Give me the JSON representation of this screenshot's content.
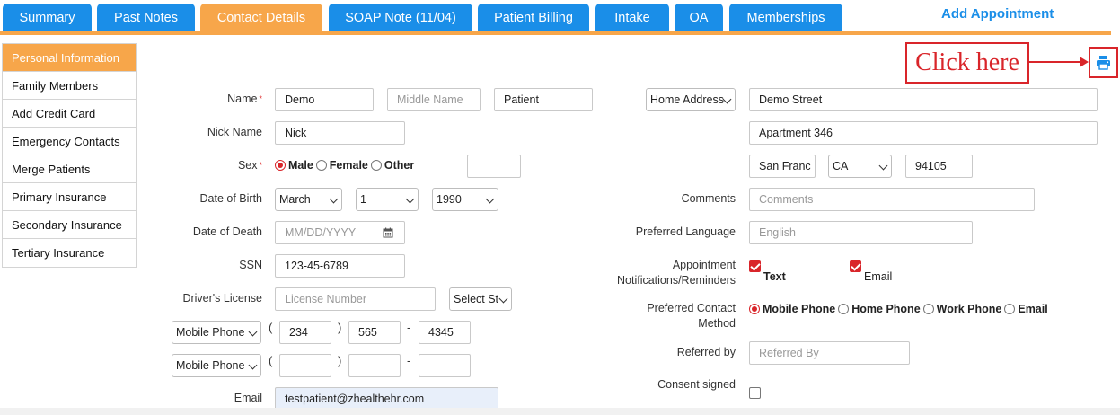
{
  "tabs": [
    {
      "label": "Summary"
    },
    {
      "label": "Past Notes"
    },
    {
      "label": "Contact Details"
    },
    {
      "label": "SOAP Note (11/04)"
    },
    {
      "label": "Patient Billing"
    },
    {
      "label": "Intake"
    },
    {
      "label": "OA"
    },
    {
      "label": "Memberships"
    }
  ],
  "active_tab": "Contact Details",
  "add_appointment": "Add Appointment",
  "sidebar": {
    "items": [
      {
        "label": "Personal Information"
      },
      {
        "label": "Family Members"
      },
      {
        "label": "Add Credit Card"
      },
      {
        "label": "Emergency Contacts"
      },
      {
        "label": "Merge Patients"
      },
      {
        "label": "Primary Insurance"
      },
      {
        "label": "Secondary Insurance"
      },
      {
        "label": "Tertiary Insurance"
      }
    ]
  },
  "annotation": {
    "callout_text": "Click here"
  },
  "form": {
    "name": {
      "label": "Name",
      "required_mark": "*",
      "first": "Demo",
      "middle_placeholder": "Middle Name",
      "last": "Patient"
    },
    "nick_name": {
      "label": "Nick Name",
      "value": "Nick"
    },
    "sex": {
      "label": "Sex",
      "required_mark": "*",
      "options": [
        "Male",
        "Female",
        "Other"
      ],
      "selected": "Male",
      "extra_value": ""
    },
    "dob": {
      "label": "Date of Birth",
      "month": "March",
      "day": "1",
      "year": "1990"
    },
    "dod": {
      "label": "Date of Death",
      "placeholder": "MM/DD/YYYY"
    },
    "ssn": {
      "label": "SSN",
      "value": "123-45-6789"
    },
    "license": {
      "label": "Driver's License",
      "placeholder": "License Number",
      "state_select": "Select St"
    },
    "phone1": {
      "type": "Mobile Phone",
      "open": "(",
      "close": ")",
      "dash": "-",
      "area": "234",
      "prefix": "565",
      "line": "4345"
    },
    "phone2": {
      "type": "Mobile Phone",
      "open": "(",
      "close": ")",
      "dash": "-",
      "area": "",
      "prefix": "",
      "line": ""
    },
    "email": {
      "label": "Email",
      "value": "testpatient@zhealthehr.com"
    },
    "address": {
      "type": "Home Address",
      "street": "Demo Street",
      "line2": "Apartment 346",
      "city": "San Franc",
      "state": "CA",
      "zip": "94105"
    },
    "comments": {
      "label": "Comments",
      "placeholder": "Comments"
    },
    "language": {
      "label": "Preferred Language",
      "placeholder": "English"
    },
    "appt_notifications": {
      "label_line1": "Appointment",
      "label_line2": "Notifications/Reminders",
      "text_label": "Text",
      "text_checked": true,
      "email_label": "Email",
      "email_checked": true
    },
    "contact_method": {
      "label_line1": "Preferred Contact",
      "label_line2": "Method",
      "options": [
        "Mobile Phone",
        "Home Phone",
        "Work Phone",
        "Email"
      ],
      "selected": "Mobile Phone"
    },
    "referred_by": {
      "label": "Referred by",
      "placeholder": "Referred By"
    },
    "consent": {
      "label": "Consent signed",
      "checked": false
    }
  },
  "colors": {
    "tab_blue": "#1a8ee8",
    "tab_active_orange": "#f7a64a",
    "annotation_red": "#d9252a"
  },
  "icons": {
    "print": "printer-icon",
    "calendar": "calendar-icon"
  }
}
